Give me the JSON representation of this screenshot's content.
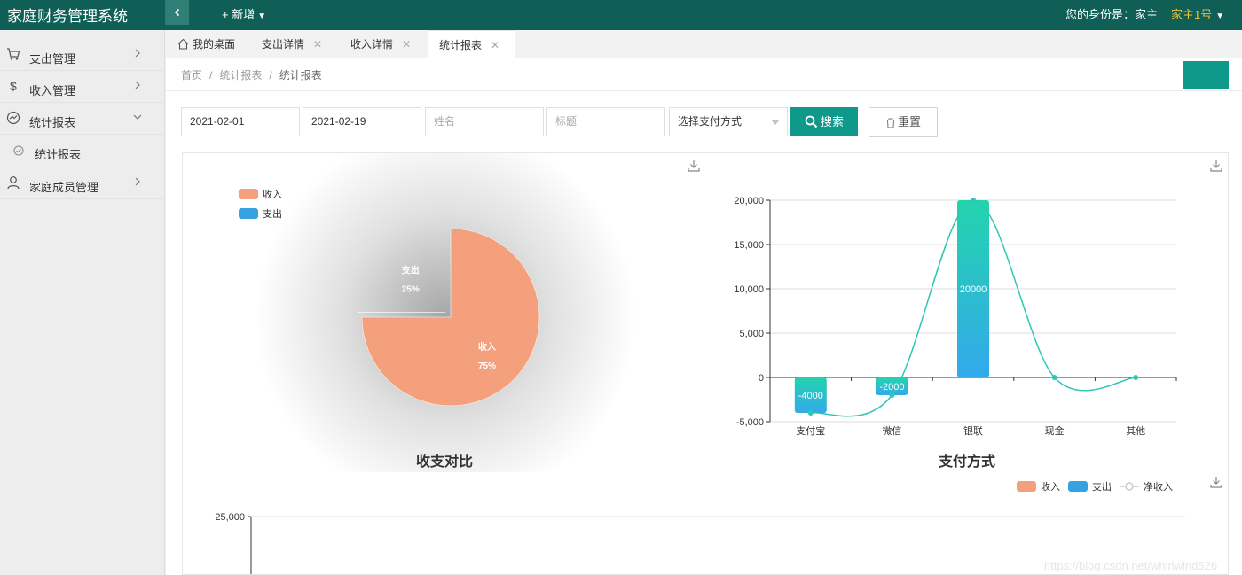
{
  "app": {
    "title": "家庭财务管理系统"
  },
  "header": {
    "collapse_icon": "chevron-left-icon",
    "new_label": "+ 新增",
    "identity_label": "您的身份是：家主",
    "user_name": "家主1号"
  },
  "sidebar": {
    "items": [
      {
        "label": "支出管理",
        "icon": "cart-icon"
      },
      {
        "label": "收入管理",
        "icon": "dollar-icon"
      },
      {
        "label": "统计报表",
        "icon": "chart-line-icon",
        "expanded": true
      },
      {
        "label": "家庭成员管理",
        "icon": "user-icon"
      }
    ],
    "sub_items": [
      {
        "label": "统计报表"
      }
    ]
  },
  "tabs": [
    {
      "label": "我的桌面",
      "closable": false
    },
    {
      "label": "支出详情",
      "closable": true
    },
    {
      "label": "收入详情",
      "closable": true
    },
    {
      "label": "统计报表",
      "closable": true,
      "active": true
    }
  ],
  "breadcrumb": [
    "首页",
    "统计报表",
    "统计报表"
  ],
  "filters": {
    "start_date": "2021-02-01",
    "end_date": "2021-02-19",
    "name_placeholder": "姓名",
    "title_placeholder": "标题",
    "payment_select": "选择支付方式",
    "search_label": "搜索",
    "reset_label": "重置"
  },
  "colors": {
    "header_bg": "#0f5f57",
    "primary": "#0f998a",
    "income": "#f4a07c",
    "expense": "#36a3e0",
    "net_income": "#2ec7b6",
    "user_name": "#f5c233"
  },
  "chart_data": [
    {
      "type": "pie",
      "title": "收支对比",
      "legend": [
        "收入",
        "支出"
      ],
      "legend_position": "top-left",
      "slices": [
        {
          "name": "收入",
          "value": 75,
          "label": "75%"
        },
        {
          "name": "支出",
          "value": 25,
          "label": "25%"
        }
      ]
    },
    {
      "type": "bar",
      "title": "支付方式",
      "categories": [
        "支付宝",
        "微信",
        "银联",
        "现金",
        "其他"
      ],
      "series": [
        {
          "name": "净收入",
          "values": [
            -4000,
            -2000,
            20000,
            0,
            0
          ],
          "data_labels": [
            "-4000",
            "-2000",
            "20000",
            "",
            ""
          ]
        }
      ],
      "ylim": [
        -5000,
        20000
      ],
      "yticks": [
        "-5,000",
        "0",
        "5,000",
        "10,000",
        "15,000",
        "20,000"
      ],
      "line_overlay": {
        "type": "smooth-line",
        "values": [
          -4000,
          -2000,
          20000,
          0,
          0
        ]
      },
      "grid": true
    },
    {
      "type": "bar",
      "title": "",
      "legend": [
        "收入",
        "支出",
        "净收入"
      ],
      "legend_position": "top-right",
      "yticks_visible": [
        "25,000"
      ],
      "grid": true
    }
  ],
  "watermark": "https://blog.csdn.net/whirlwind526"
}
